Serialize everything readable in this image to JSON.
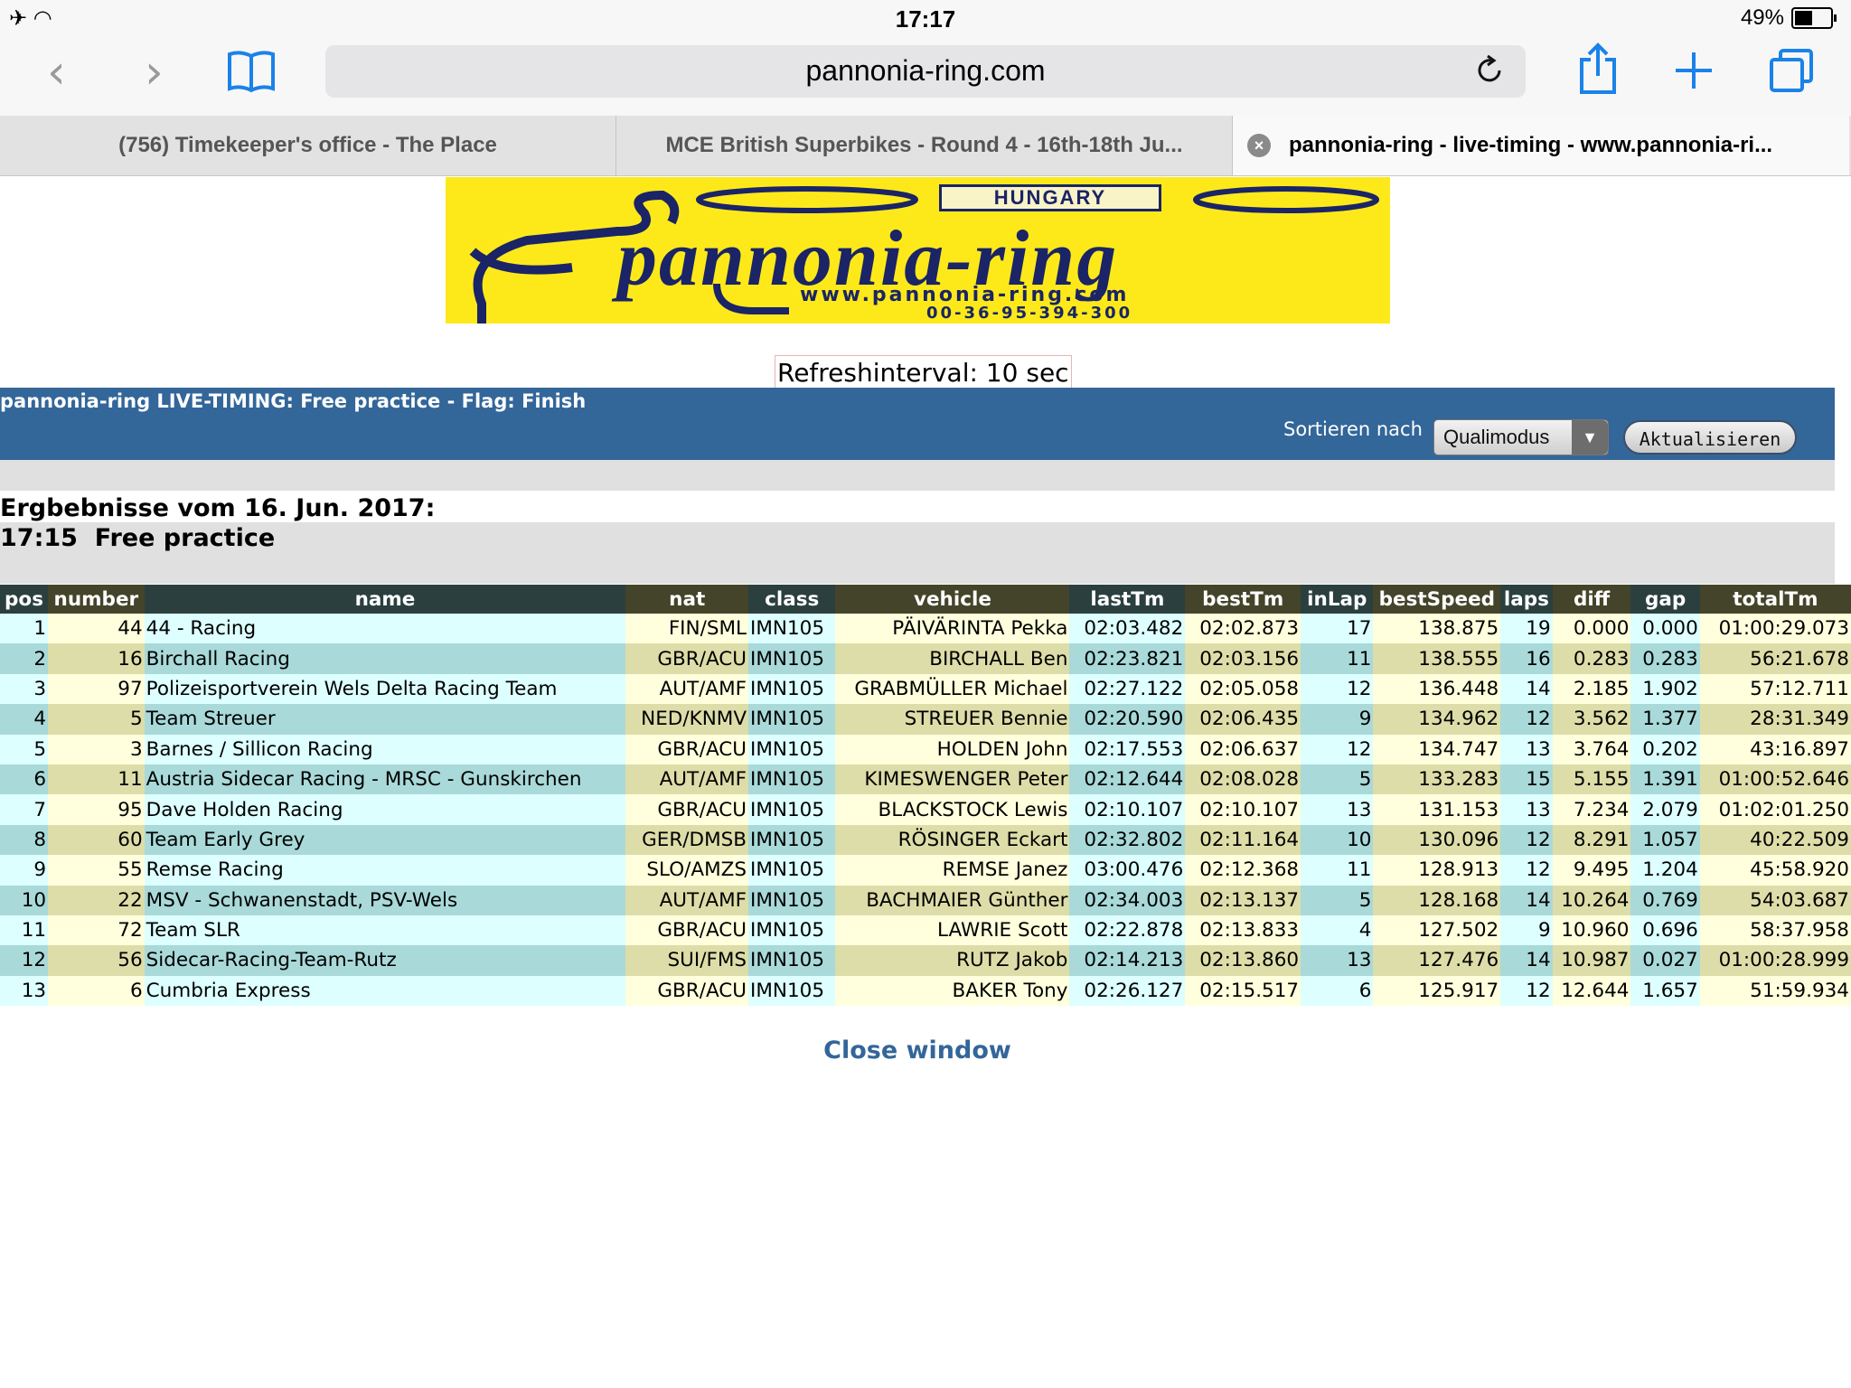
{
  "status": {
    "left": "✈  ◠",
    "time": "17:17",
    "battery": "49%",
    "battery_level": 0.49
  },
  "toolbar": {
    "url": "pannonia-ring.com"
  },
  "tabs": [
    {
      "label": "(756) Timekeeper's office - The Place"
    },
    {
      "label": "MCE British Superbikes - Round 4 - 16th-18th Ju..."
    },
    {
      "label": "pannonia-ring - live-timing - www.pannonia-ri...",
      "close": "×"
    }
  ],
  "banner": {
    "hungary": "HUNGARY",
    "brand": "pannonia-ring",
    "www": "www.pannonia-ring.com",
    "phone": "00-36-95-394-300"
  },
  "refresh": "Refreshinterval: 10 sec",
  "live": {
    "title": "pannonia-ring LIVE-TIMING: Free practice - Flag: Finish",
    "sort_label": "Sortieren nach",
    "sort_value": "Qualimodus",
    "update_button": "Aktualisieren"
  },
  "results_date": "Ergbebnisse vom 16. Jun. 2017:",
  "session": "17:15  Free practice",
  "table": {
    "headers": [
      "pos",
      "number",
      "name",
      "nat",
      "class",
      "vehicle",
      "lastTm",
      "bestTm",
      "inLap",
      "bestSpeed",
      "laps",
      "diff",
      "gap",
      "totalTm"
    ],
    "rows": [
      [
        "1",
        "44",
        "44 - Racing",
        "FIN/SML",
        "IMN105",
        "PÄIVÄRINTA Pekka",
        "02:03.482",
        "02:02.873",
        "17",
        "138.875",
        "19",
        "0.000",
        "0.000",
        "01:00:29.073"
      ],
      [
        "2",
        "16",
        "Birchall Racing",
        "GBR/ACU",
        "IMN105",
        "BIRCHALL Ben",
        "02:23.821",
        "02:03.156",
        "11",
        "138.555",
        "16",
        "0.283",
        "0.283",
        "56:21.678"
      ],
      [
        "3",
        "97",
        "Polizeisportverein Wels Delta Racing Team",
        "AUT/AMF",
        "IMN105",
        "GRABMÜLLER Michael",
        "02:27.122",
        "02:05.058",
        "12",
        "136.448",
        "14",
        "2.185",
        "1.902",
        "57:12.711"
      ],
      [
        "4",
        "5",
        "Team Streuer",
        "NED/KNMV",
        "IMN105",
        "STREUER Bennie",
        "02:20.590",
        "02:06.435",
        "9",
        "134.962",
        "12",
        "3.562",
        "1.377",
        "28:31.349"
      ],
      [
        "5",
        "3",
        "Barnes / Sillicon Racing",
        "GBR/ACU",
        "IMN105",
        "HOLDEN John",
        "02:17.553",
        "02:06.637",
        "12",
        "134.747",
        "13",
        "3.764",
        "0.202",
        "43:16.897"
      ],
      [
        "6",
        "11",
        "Austria Sidecar Racing - MRSC - Gunskirchen",
        "AUT/AMF",
        "IMN105",
        "KIMESWENGER Peter",
        "02:12.644",
        "02:08.028",
        "5",
        "133.283",
        "15",
        "5.155",
        "1.391",
        "01:00:52.646"
      ],
      [
        "7",
        "95",
        "Dave Holden Racing",
        "GBR/ACU",
        "IMN105",
        "BLACKSTOCK Lewis",
        "02:10.107",
        "02:10.107",
        "13",
        "131.153",
        "13",
        "7.234",
        "2.079",
        "01:02:01.250"
      ],
      [
        "8",
        "60",
        "Team Early Grey",
        "GER/DMSB",
        "IMN105",
        "RÖSINGER Eckart",
        "02:32.802",
        "02:11.164",
        "10",
        "130.096",
        "12",
        "8.291",
        "1.057",
        "40:22.509"
      ],
      [
        "9",
        "55",
        "Remse Racing",
        "SLO/AMZS",
        "IMN105",
        "REMSE Janez",
        "03:00.476",
        "02:12.368",
        "11",
        "128.913",
        "12",
        "9.495",
        "1.204",
        "45:58.920"
      ],
      [
        "10",
        "22",
        "MSV - Schwanenstadt, PSV-Wels",
        "AUT/AMF",
        "IMN105",
        "BACHMAIER Günther",
        "02:34.003",
        "02:13.137",
        "5",
        "128.168",
        "14",
        "10.264",
        "0.769",
        "54:03.687"
      ],
      [
        "11",
        "72",
        "Team SLR",
        "GBR/ACU",
        "IMN105",
        "LAWRIE Scott",
        "02:22.878",
        "02:13.833",
        "4",
        "127.502",
        "9",
        "10.960",
        "0.696",
        "58:37.958"
      ],
      [
        "12",
        "56",
        "Sidecar-Racing-Team-Rutz",
        "SUI/FMS",
        "IMN105",
        "RUTZ Jakob",
        "02:14.213",
        "02:13.860",
        "13",
        "127.476",
        "14",
        "10.987",
        "0.027",
        "01:00:28.999"
      ],
      [
        "13",
        "6",
        "Cumbria Express",
        "GBR/ACU",
        "IMN105",
        "BAKER Tony",
        "02:26.127",
        "02:15.517",
        "6",
        "125.917",
        "12",
        "12.644",
        "1.657",
        "51:59.934"
      ]
    ]
  },
  "close_link": "Close window",
  "colors": {
    "header_blue": "#336699",
    "banner_yellow": "#fde91a",
    "ios_blue": "#1a82e8"
  }
}
